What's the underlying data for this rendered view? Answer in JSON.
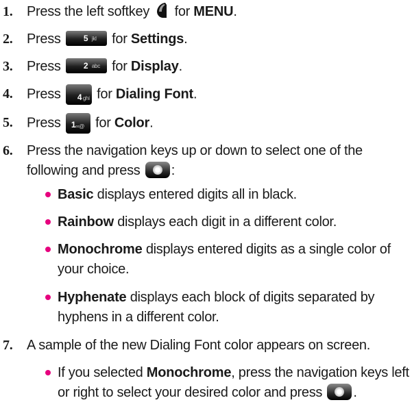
{
  "steps": [
    {
      "num": "1.",
      "pre": "Press the left softkey",
      "key_icon": "left-softkey-icon",
      "mid": "for",
      "bold": "MENU",
      "post": "."
    },
    {
      "num": "2.",
      "pre": "Press",
      "key_icon": "key-5-icon",
      "key_digit": "5",
      "key_sub": "jkl",
      "mid": "for",
      "bold": "Settings",
      "post": "."
    },
    {
      "num": "3.",
      "pre": "Press",
      "key_icon": "key-2-icon",
      "key_digit": "2",
      "key_sub": "abc",
      "mid": "for",
      "bold": "Display",
      "post": "."
    },
    {
      "num": "4.",
      "pre": "Press",
      "key_icon": "key-4-icon",
      "key_digit": "4",
      "key_sub": "ghi",
      "mid": "for",
      "bold": "Dialing Font",
      "post": "."
    },
    {
      "num": "5.",
      "pre": "Press",
      "key_icon": "key-1-icon",
      "key_digit": "1",
      "key_sub": "∞@",
      "mid": "for",
      "bold": "Color",
      "post": "."
    },
    {
      "num": "6.",
      "line1": "Press the navigation keys up or down to select one of the",
      "line2_pre": "following and press",
      "key_icon": "ok-key-icon",
      "line2_post": ":"
    },
    {
      "num": "7.",
      "text": "A sample of the new Dialing Font color appears on screen."
    }
  ],
  "options": [
    {
      "bold": "Basic",
      "text": " displays entered digits all in black."
    },
    {
      "bold": "Rainbow",
      "text": " displays each digit in a different color."
    },
    {
      "bold": "Monochrome",
      "text": " displays entered digits as a single color of",
      "text2": "your choice."
    },
    {
      "bold": "Hyphenate",
      "text": " displays each block of digits separated by",
      "text2": "hyphens in a different color."
    }
  ],
  "note": {
    "pre": "If you selected ",
    "bold": "Monochrome",
    "post": ", press the navigation keys left",
    "line2_pre": "or right to select your desired color and press",
    "key_icon": "ok-key-icon",
    "line2_post": "."
  },
  "colors": {
    "bullet": "#e6007e",
    "text": "#1a1a1a",
    "key": "#000000"
  }
}
